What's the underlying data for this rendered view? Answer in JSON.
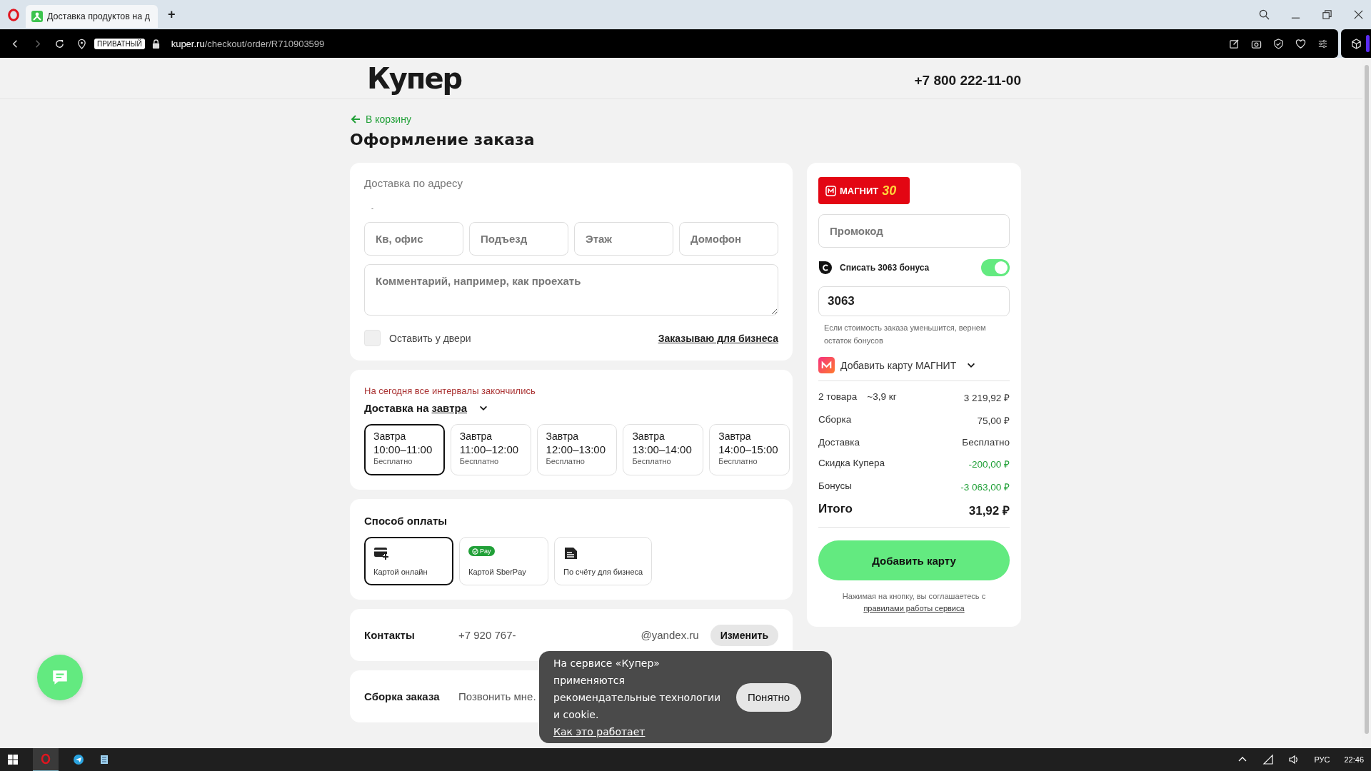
{
  "browser": {
    "tab_title": "Доставка продуктов на д",
    "new_tab": "+",
    "private_badge": "ПРИВАТНЫЙ",
    "url_domain": "kuper.ru",
    "url_path": "/checkout/order/R710903599"
  },
  "header": {
    "logo": "Купер",
    "phone": "+7 800 222-11-00"
  },
  "back_link": "В корзину",
  "title": "Оформление заказа",
  "address_card": {
    "heading": "Доставка по адресу",
    "address": "-",
    "fields": [
      {
        "placeholder": "Кв, офис"
      },
      {
        "placeholder": "Подъезд"
      },
      {
        "placeholder": "Этаж"
      },
      {
        "placeholder": "Домофон"
      }
    ],
    "comment": {
      "placeholder": "Комментарий, например, как проехать"
    },
    "leave_at_door": {
      "label": "Оставить у двери",
      "checked": false
    },
    "business_link": "Заказываю для бизнеса"
  },
  "interval_card": {
    "notice": "На сегодня все интервалы закончились",
    "prefix": "Доставка на",
    "day": "завтра",
    "slots": [
      {
        "day": "Завтра",
        "time": "10:00–11:00",
        "price": "Бесплатно",
        "selected": true
      },
      {
        "day": "Завтра",
        "time": "11:00–12:00",
        "price": "Бесплатно",
        "selected": false
      },
      {
        "day": "Завтра",
        "time": "12:00–13:00",
        "price": "Бесплатно",
        "selected": false
      },
      {
        "day": "Завтра",
        "time": "13:00–14:00",
        "price": "Бесплатно",
        "selected": false
      },
      {
        "day": "Завтра",
        "time": "14:00–15:00",
        "price": "Бесплатно",
        "selected": false
      }
    ]
  },
  "payment_card": {
    "title": "Способ оплаты",
    "methods": [
      {
        "kind": "card",
        "label": "Картой онлайн",
        "selected": true
      },
      {
        "kind": "sberpay",
        "label": "Картой SberPay",
        "badge": "Pay",
        "selected": false
      },
      {
        "kind": "invoice",
        "label": "По счёту для бизнеса",
        "selected": false
      }
    ]
  },
  "contacts": {
    "label": "Контакты",
    "phone": "+7 920 767-",
    "email": "@yandex.ru",
    "button": "Изменить"
  },
  "assembly": {
    "label": "Сборка заказа",
    "value": "Позвонить мне."
  },
  "summary": {
    "brand": "МАГНИТ",
    "brand_badge": "30",
    "promo": {
      "placeholder": "Промокод"
    },
    "bonus": {
      "label": "Списать 3063 бонуса",
      "on": true
    },
    "bonus_value": "3063",
    "bonus_note": "Если стоимость заказа уменьшится, вернем остаток бонусов",
    "add_card": "Добавить карту МАГНИТ",
    "rows": [
      {
        "label": "2 товара",
        "extra": "~3,9 кг",
        "value": "3 219,92 ₽",
        "kind": "normal"
      },
      {
        "label": "Сборка",
        "value": "75,00 ₽",
        "kind": "normal"
      },
      {
        "label": "Доставка",
        "value": "Бесплатно",
        "kind": "normal"
      },
      {
        "label": "Скидка Купера",
        "value": "-200,00 ₽",
        "kind": "discount"
      },
      {
        "label": "Бонусы",
        "value": "-3 063,00 ₽",
        "kind": "discount"
      }
    ],
    "total_label": "Итого",
    "total_value": "31,92 ₽",
    "button": "Добавить карту",
    "terms": "Нажимая на кнопку, вы соглашаетесь с",
    "terms_link": "правилами работы сервиса"
  },
  "cookie": {
    "text": "На сервисе «Купер» применяются рекомендательные технологии и cookie.",
    "link": "Как это работает",
    "button": "Понятно"
  },
  "taskbar": {
    "language": "РУС",
    "time": "22:46"
  }
}
